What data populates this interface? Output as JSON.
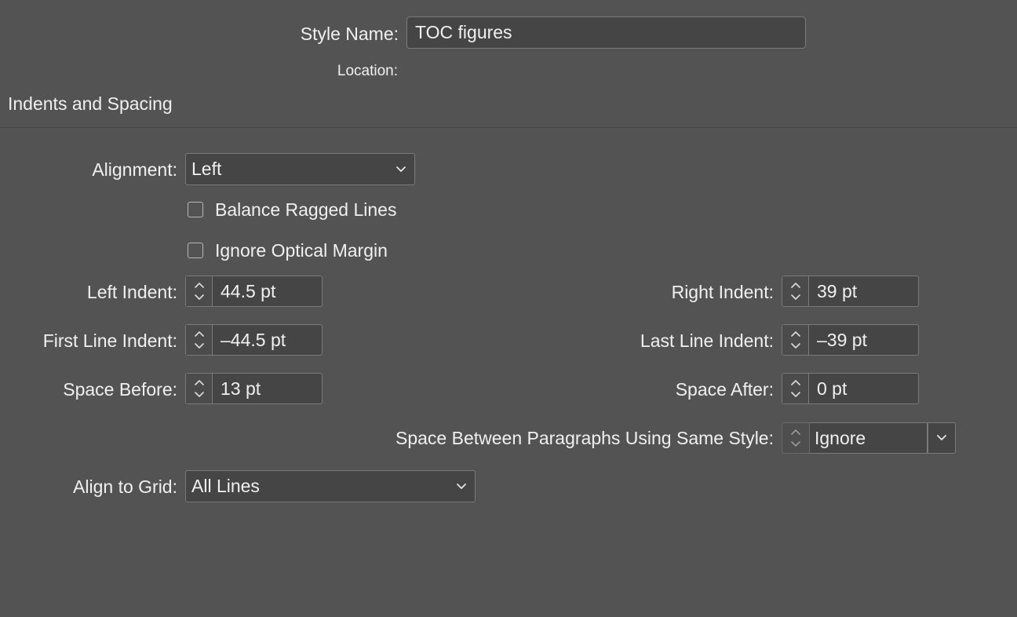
{
  "header": {
    "style_name_label": "Style Name:",
    "style_name_value": "TOC figures",
    "location_label": "Location:"
  },
  "section": {
    "title": "Indents and Spacing"
  },
  "alignment": {
    "label": "Alignment:",
    "value": "Left"
  },
  "checkboxes": {
    "balance_ragged_lines": {
      "label": "Balance Ragged Lines",
      "checked": false
    },
    "ignore_optical_margin": {
      "label": "Ignore Optical Margin",
      "checked": false
    }
  },
  "fields": {
    "left_indent": {
      "label": "Left Indent:",
      "value": "44.5 pt"
    },
    "right_indent": {
      "label": "Right Indent:",
      "value": "39 pt"
    },
    "first_line_indent": {
      "label": "First Line Indent:",
      "value": "–44.5 pt"
    },
    "last_line_indent": {
      "label": "Last Line Indent:",
      "value": "–39 pt"
    },
    "space_before": {
      "label": "Space Before:",
      "value": "13 pt"
    },
    "space_after": {
      "label": "Space After:",
      "value": "0 pt"
    }
  },
  "space_between": {
    "label": "Space Between Paragraphs Using Same Style:",
    "value": "Ignore"
  },
  "align_to_grid": {
    "label": "Align to Grid:",
    "value": "All Lines"
  },
  "icons": {
    "stepper": "up-down-arrows-icon",
    "dropdown": "chevron-down-icon"
  }
}
